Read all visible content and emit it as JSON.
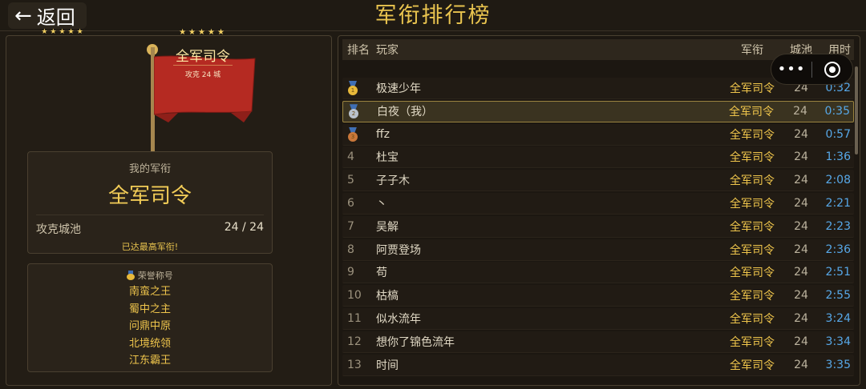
{
  "header": {
    "back_label": "返回",
    "title": "军衔排行榜"
  },
  "flag": {
    "stars": "★★★★★",
    "rank": "全军司令",
    "sub": "攻克 24 城"
  },
  "my_rank": {
    "label": "我的军衔",
    "value": "全军司令",
    "conquer_label": "攻克城池",
    "conquer_value": "24 / 24",
    "note": "已达最高军衔!"
  },
  "honor": {
    "title": "荣誉称号",
    "items": [
      "南蛮之王",
      "蜀中之主",
      "问鼎中原",
      "北境统领",
      "江东霸王"
    ]
  },
  "table": {
    "headers": {
      "rank": "排名",
      "player": "玩家",
      "title": "军衔",
      "city": "城池",
      "time": "用时"
    },
    "rows": [
      {
        "rank": "1",
        "player": "极速少年",
        "title": "全军司令",
        "city": "24",
        "time": "0:32"
      },
      {
        "rank": "2",
        "player": "白夜（我）",
        "title": "全军司令",
        "city": "24",
        "time": "0:35"
      },
      {
        "rank": "3",
        "player": "ffz",
        "title": "全军司令",
        "city": "24",
        "time": "0:57"
      },
      {
        "rank": "4",
        "player": "杜宝",
        "title": "全军司令",
        "city": "24",
        "time": "1:36"
      },
      {
        "rank": "5",
        "player": "子子木",
        "title": "全军司令",
        "city": "24",
        "time": "2:08"
      },
      {
        "rank": "6",
        "player": "丶",
        "title": "全军司令",
        "city": "24",
        "time": "2:21"
      },
      {
        "rank": "7",
        "player": "吴解",
        "title": "全军司令",
        "city": "24",
        "time": "2:23"
      },
      {
        "rank": "8",
        "player": "阿贾登场",
        "title": "全军司令",
        "city": "24",
        "time": "2:36"
      },
      {
        "rank": "9",
        "player": "苟",
        "title": "全军司令",
        "city": "24",
        "time": "2:51"
      },
      {
        "rank": "10",
        "player": "枯槁",
        "title": "全军司令",
        "city": "24",
        "time": "2:55"
      },
      {
        "rank": "11",
        "player": "似水流年",
        "title": "全军司令",
        "city": "24",
        "time": "3:24"
      },
      {
        "rank": "12",
        "player": "想你了锦色流年",
        "title": "全军司令",
        "city": "24",
        "time": "3:34"
      },
      {
        "rank": "13",
        "player": "时间",
        "title": "全军司令",
        "city": "24",
        "time": "3:35"
      }
    ]
  },
  "colors": {
    "accent_gold": "#e9c44f",
    "time_blue": "#57a8e8",
    "flag_red": "#b52a22",
    "medal_gold": "#e8b93a",
    "medal_silver": "#b9c2cc",
    "medal_bronze": "#c9773a"
  },
  "icons": {
    "back": "arrow-left-icon",
    "medal": "medal-icon",
    "more": "more-dots-icon",
    "close": "target-close-icon"
  }
}
